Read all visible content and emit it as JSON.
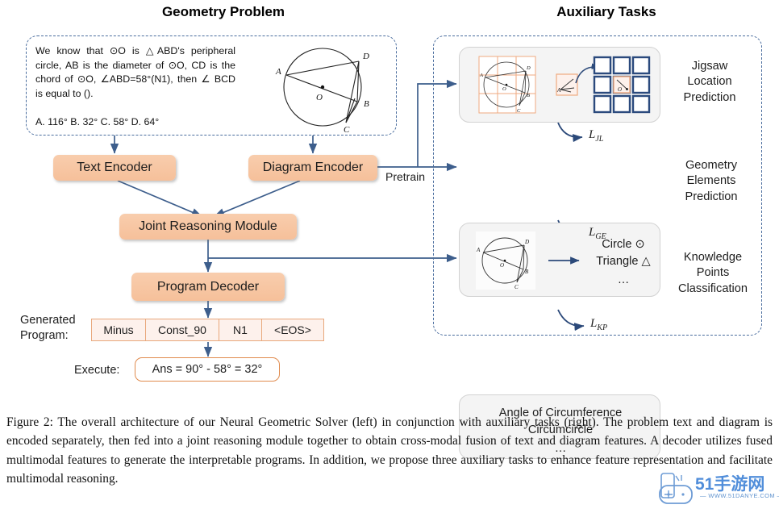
{
  "headings": {
    "left": "Geometry Problem",
    "right": "Auxiliary Tasks"
  },
  "problem": {
    "text": "We know that ⊙O is △ABD's peripheral circle, AB is the diameter of ⊙O, CD is the chord of ⊙O, ∠ABD=58°(N1), then ∠ BCD is equal to ().",
    "options": "A. 116°  B. 32°  C. 58°  D. 64°",
    "diagram_labels": {
      "a": "A",
      "b": "B",
      "c": "C",
      "d": "D",
      "o": "O"
    }
  },
  "modules": {
    "text_encoder": "Text Encoder",
    "diagram_encoder": "Diagram Encoder",
    "joint_reasoning": "Joint Reasoning Module",
    "program_decoder": "Program Decoder"
  },
  "edges": {
    "pretrain": "Pretrain"
  },
  "program": {
    "label_line1": "Generated",
    "label_line2": "Program:",
    "tokens": [
      "Minus",
      "Const_90",
      "N1",
      "<EOS>"
    ],
    "execute_label": "Execute:",
    "execute_value": "Ans = 90° - 58° = 32°"
  },
  "aux_tasks": [
    {
      "id": "jigsaw",
      "name_lines": [
        "Jigsaw",
        "Location",
        "Prediction"
      ],
      "loss": "L",
      "loss_sub": "JL",
      "patch_label": "A",
      "grid_label": "O"
    },
    {
      "id": "geometry-elements",
      "name_lines": [
        "Geometry",
        "Elements",
        "Prediction"
      ],
      "loss": "L",
      "loss_sub": "GE",
      "items": [
        "Circle ⊙",
        "Triangle △",
        "…"
      ]
    },
    {
      "id": "knowledge-points",
      "name_lines": [
        "Knowledge",
        "Points",
        "Classification"
      ],
      "loss": "L",
      "loss_sub": "KP",
      "items": [
        "Angle of Circumference",
        "Circumcircle",
        "…"
      ]
    }
  ],
  "caption": "Figure 2: The overall architecture of our Neural Geometric Solver (left) in conjunction with auxiliary tasks (right). The problem text and diagram is encoded separately, then fed into a joint reasoning module together to obtain cross-modal fusion of text and diagram features. A decoder utilizes fused multimodal features to generate the interpretable programs. In addition, we propose three auxiliary tasks to enhance feature representation and facilitate multimodal reasoning.",
  "watermark": {
    "brand": "51手游网",
    "url": "— WWW.51DANYE.COM —"
  },
  "colors": {
    "module_fill": "#f6c09a",
    "arrow": "#3d5e8c",
    "dashed_border": "#4a6d9e",
    "program_cell_border": "#e8a87c",
    "program_cell_fill": "#fdf1ec",
    "card_fill": "#f4f4f4",
    "jigsaw_tile": "#2b4a7d",
    "grid_overlay": "#efaa80"
  }
}
